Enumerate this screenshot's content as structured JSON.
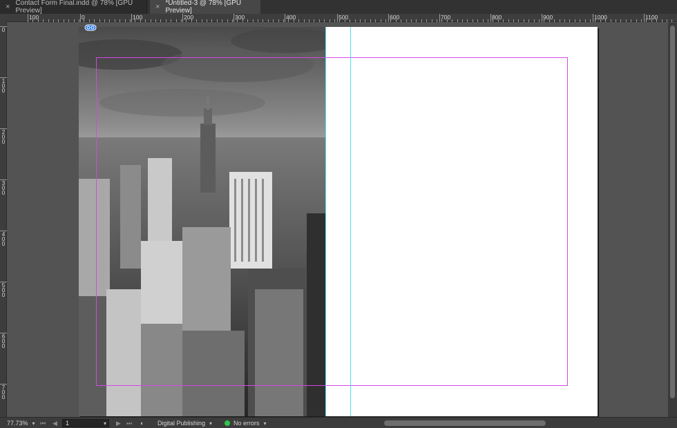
{
  "tabs": [
    {
      "label": "Contact Form Final.indd @ 78% [GPU Preview]",
      "active": false
    },
    {
      "label": "*Untitled-3 @ 78% [GPU Preview]",
      "active": true
    }
  ],
  "ruler_top": {
    "labels": [
      "100",
      "0",
      "100",
      "200",
      "300",
      "400",
      "500",
      "600",
      "700",
      "800",
      "900",
      "1000",
      "1100"
    ]
  },
  "ruler_left": {
    "labels": [
      "0",
      "100",
      "200",
      "300",
      "400",
      "500",
      "600",
      "700"
    ]
  },
  "photo": {
    "subject": "black and white Manhattan skyline with Empire State Building"
  },
  "colors": {
    "guide": "#4fe0ea",
    "margin": "#d447e6",
    "status_ok": "#2ec84a"
  },
  "status": {
    "zoom": "77.73%",
    "page": "1",
    "workspace": "Digital Publishing",
    "preflight": "No errors"
  },
  "icons": [
    "close-icon",
    "link-icon",
    "first-page-icon",
    "prev-page-icon",
    "next-page-icon",
    "last-page-icon",
    "preview-icon",
    "chevron-down-icon"
  ]
}
